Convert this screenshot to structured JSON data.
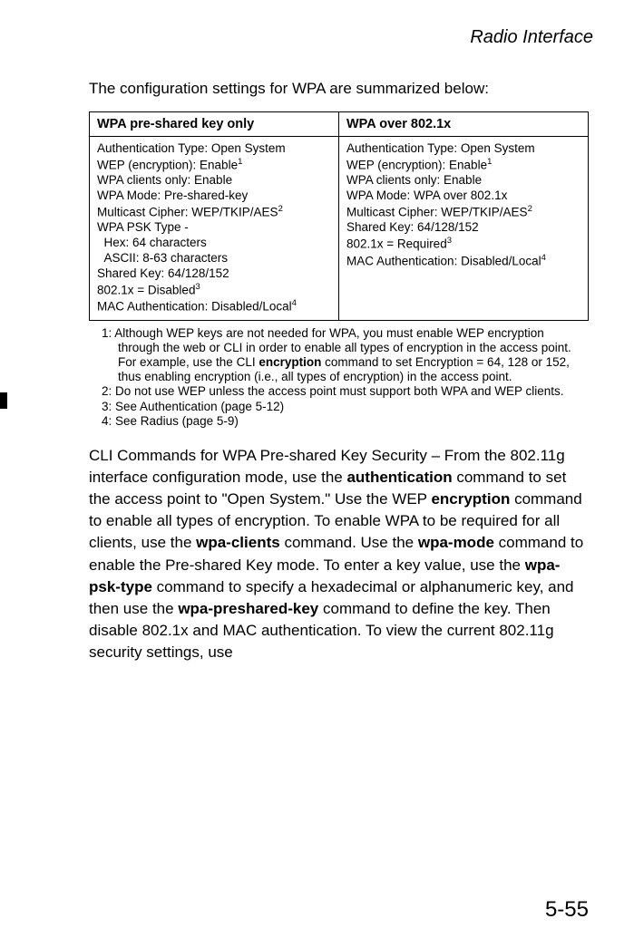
{
  "header": {
    "title": "Radio Interface"
  },
  "intro": "The configuration settings for WPA are summarized below:",
  "table": {
    "header_left": "WPA pre-shared key only",
    "header_right": "WPA over 802.1x",
    "left": {
      "l1": "Authentication Type: Open System",
      "l2a": "WEP (encryption): Enable",
      "l2sup": "1",
      "l3": "WPA clients only: Enable",
      "l4": "WPA Mode: Pre-shared-key",
      "l5a": "Multicast Cipher: WEP/TKIP/AES",
      "l5sup": "2",
      "l6": "WPA PSK Type -",
      "l7": "  Hex: 64 characters",
      "l8": "  ASCII: 8-63 characters",
      "l9": "Shared Key: 64/128/152",
      "l10a": "802.1x = Disabled",
      "l10sup": "3",
      "l11a": "MAC Authentication: Disabled/Local",
      "l11sup": "4"
    },
    "right": {
      "r1": "Authentication Type: Open System",
      "r2a": "WEP (encryption): Enable",
      "r2sup": "1",
      "r3": "WPA clients only: Enable",
      "r4": "WPA Mode: WPA over 802.1x",
      "r5a": "Multicast Cipher: WEP/TKIP/AES",
      "r5sup": "2",
      "r6": "Shared Key: 64/128/152",
      "r7a": "802.1x = Required",
      "r7sup": "3",
      "r8a": "MAC Authentication: Disabled/Local",
      "r8sup": "4"
    }
  },
  "footnotes": {
    "f1n": "1:",
    "f1a": "Although WEP keys are not needed for WPA, you must enable WEP encryption through the web or CLI in order to enable all types of encryption in the access point. For example, use the CLI ",
    "f1b": "encryption",
    "f1c": " command to set Encryption = 64, 128 or 152, thus enabling encryption (i.e., all types of encryption) in the access point.",
    "f2n": "2:",
    "f2": "Do not use WEP unless the access point must support both WPA and WEP clients.",
    "f3n": "3:",
    "f3": "See Authentication (page 5-12)",
    "f4n": "4:",
    "f4": "See Radius (page 5-9)"
  },
  "body": {
    "p1a": "CLI Commands for WPA Pre-shared Key Security – From the 802.11g interface configuration mode, use the ",
    "p1b": "authentication",
    "p1c": " command to set the access point to \"Open System.\" Use the WEP ",
    "p1d": "encryption",
    "p1e": " command to enable all types of encryption. To enable WPA to be required for all clients, use the ",
    "p1f": "wpa-clients",
    "p1g": " command. Use the ",
    "p1h": "wpa-mode",
    "p1i": " command to enable the Pre-shared Key mode. To enter a key value, use the ",
    "p1j": "wpa-psk-type",
    "p1k": " command to specify a hexadecimal or alphanumeric key, and then use the ",
    "p1l": "wpa-preshared-key",
    "p1m": " command to define the key. Then disable 802.1x and MAC authentication. To view the current 802.11g security settings, use"
  },
  "page_num": "5-55"
}
